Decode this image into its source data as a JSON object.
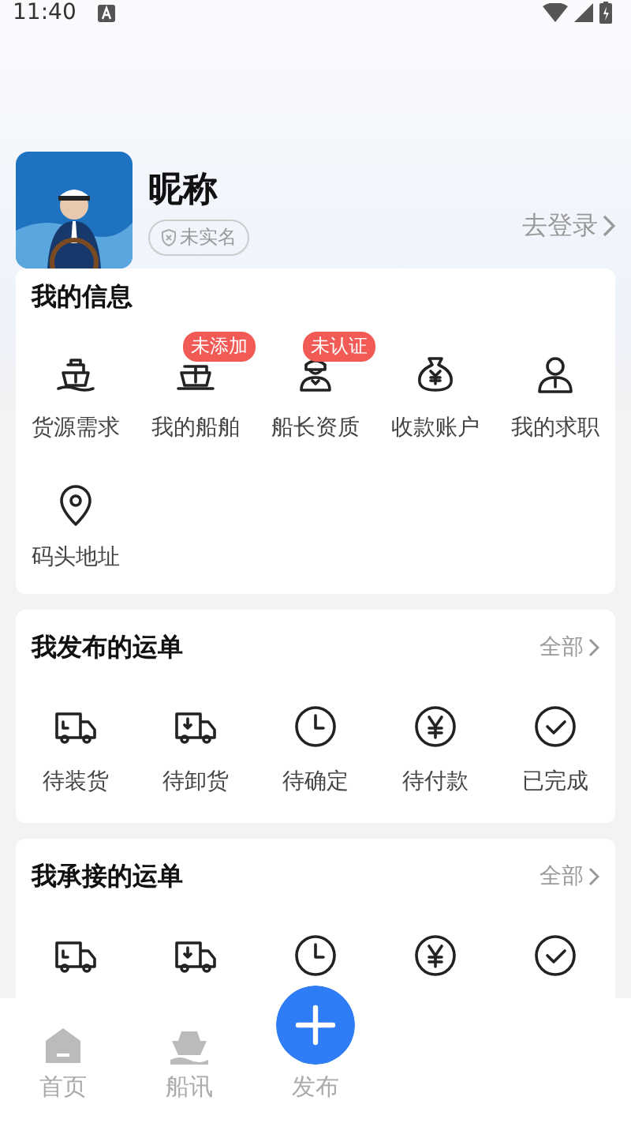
{
  "status_bar": {
    "time": "11:40"
  },
  "profile": {
    "nickname": "昵称",
    "verify_badge": "未实名",
    "login_link": "去登录"
  },
  "info_card": {
    "title": "我的信息",
    "items": [
      {
        "label": "货源需求"
      },
      {
        "label": "我的船舶",
        "badge": "未添加"
      },
      {
        "label": "船长资质",
        "badge": "未认证"
      },
      {
        "label": "收款账户"
      },
      {
        "label": "我的求职"
      },
      {
        "label": "码头地址"
      }
    ]
  },
  "order_cards": [
    {
      "title": "我发布的运单",
      "all_link": "全部",
      "items": [
        {
          "label": "待装货"
        },
        {
          "label": "待卸货"
        },
        {
          "label": "待确定"
        },
        {
          "label": "待付款"
        },
        {
          "label": "已完成"
        }
      ]
    },
    {
      "title": "我承接的运单",
      "all_link": "全部"
    }
  ],
  "bottom_nav": [
    {
      "label": "首页",
      "kind": "home",
      "selected": false
    },
    {
      "label": "船讯",
      "kind": "ship",
      "selected": false
    },
    {
      "label": "发布",
      "kind": "publish",
      "selected": false
    }
  ]
}
